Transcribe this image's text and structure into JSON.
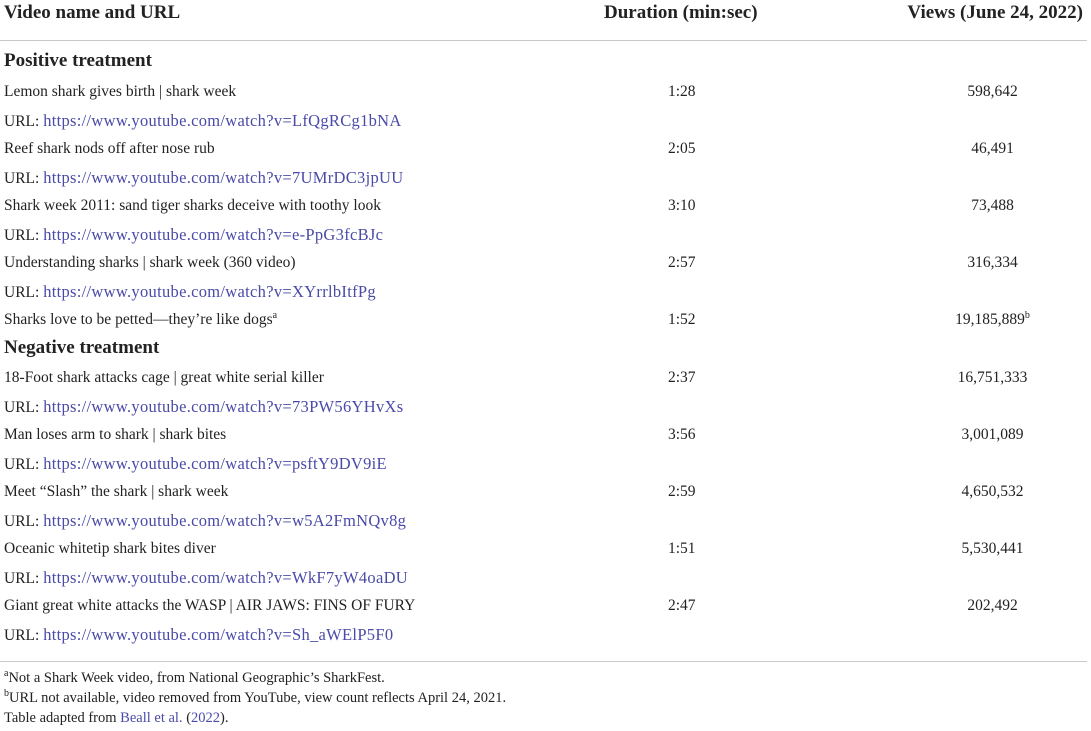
{
  "header": {
    "name": "Video name and URL",
    "duration": "Duration (min:sec)",
    "views": "Views (June 24, 2022)"
  },
  "url_label": "URL:",
  "sections": [
    {
      "title": "Positive treatment",
      "rows": [
        {
          "name": "Lemon shark gives birth | shark week",
          "duration": "1:28",
          "views": "598,642",
          "url": "https://www.youtube.com/watch?v=LfQgRCg1bNA"
        },
        {
          "name": "Reef shark nods off after nose rub",
          "duration": "2:05",
          "views": "46,491",
          "url": "https://www.youtube.com/watch?v=7UMrDC3jpUU"
        },
        {
          "name": "Shark week 2011: sand tiger sharks deceive with toothy look",
          "duration": "3:10",
          "views": "73,488",
          "url": "https://www.youtube.com/watch?v=e-PpG3fcBJc"
        },
        {
          "name": "Understanding sharks | shark week (360 video)",
          "duration": "2:57",
          "views": "316,334",
          "url": "https://www.youtube.com/watch?v=XYrrlbItfPg"
        },
        {
          "name": "Sharks love to be petted—they’re like dogs",
          "name_sup": "a",
          "duration": "1:52",
          "views": "19,185,889",
          "views_sup": "b"
        }
      ]
    },
    {
      "title": "Negative treatment",
      "rows": [
        {
          "name": "18-Foot shark attacks cage | great white serial killer",
          "duration": "2:37",
          "views": "16,751,333",
          "url": "https://www.youtube.com/watch?v=73PW56YHvXs"
        },
        {
          "name": "Man loses arm to shark | shark bites",
          "duration": "3:56",
          "views": "3,001,089",
          "url": "https://www.youtube.com/watch?v=psftY9DV9iE"
        },
        {
          "name": "Meet “Slash” the shark | shark week",
          "duration": "2:59",
          "views": "4,650,532",
          "url": "https://www.youtube.com/watch?v=w5A2FmNQv8g"
        },
        {
          "name": "Oceanic whitetip shark bites diver",
          "duration": "1:51",
          "views": "5,530,441",
          "url": "https://www.youtube.com/watch?v=WkF7yW4oaDU"
        },
        {
          "name": "Giant great white attacks the WASP | AIR JAWS: FINS OF FURY",
          "duration": "2:47",
          "views": "202,492",
          "url": "https://www.youtube.com/watch?v=Sh_aWElP5F0"
        }
      ]
    }
  ],
  "footnotes": {
    "a_mark": "a",
    "a_text": "Not a Shark Week video, from National Geographic’s SharkFest.",
    "b_mark": "b",
    "b_text": "URL not available, video removed from YouTube, view count reflects April 24, 2021.",
    "adapted_prefix": "Table adapted from ",
    "adapted_link": "Beall et al.",
    "adapted_open": " (",
    "adapted_year": "2022",
    "adapted_close": ")."
  },
  "colors": {
    "link": "#4a4aa8",
    "rule": "#c9c9c9",
    "text": "#222222"
  }
}
